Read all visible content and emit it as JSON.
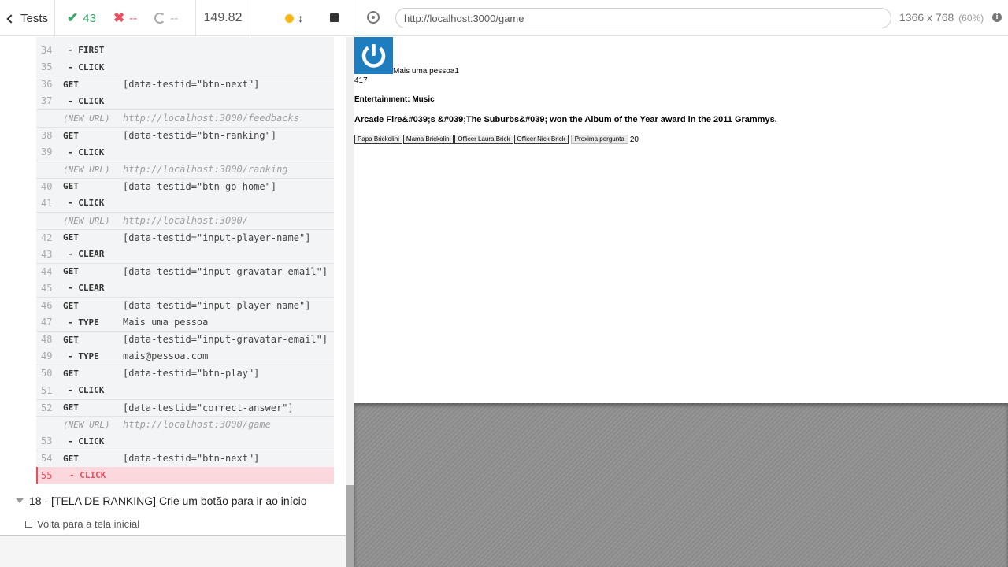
{
  "reporter": {
    "header": {
      "tests_label": "Tests",
      "passed": "43",
      "failed": "--",
      "pending": "--",
      "duration": "149.82"
    },
    "commands": [
      {
        "num": "34",
        "name": "-FIRST",
        "msg": ""
      },
      {
        "num": "35",
        "name": "-CLICK",
        "msg": ""
      },
      {
        "num": "36",
        "name": "GET",
        "msg": "[data-testid=\"btn-next\"]"
      },
      {
        "num": "37",
        "name": "-CLICK",
        "msg": ""
      },
      {
        "num": "",
        "name": "(NEW URL)",
        "msg": "http://localhost:3000/feedbacks"
      },
      {
        "num": "38",
        "name": "GET",
        "msg": "[data-testid=\"btn-ranking\"]"
      },
      {
        "num": "39",
        "name": "-CLICK",
        "msg": ""
      },
      {
        "num": "",
        "name": "(NEW URL)",
        "msg": "http://localhost:3000/ranking"
      },
      {
        "num": "40",
        "name": "GET",
        "msg": "[data-testid=\"btn-go-home\"]"
      },
      {
        "num": "41",
        "name": "-CLICK",
        "msg": ""
      },
      {
        "num": "",
        "name": "(NEW URL)",
        "msg": "http://localhost:3000/"
      },
      {
        "num": "42",
        "name": "GET",
        "msg": "[data-testid=\"input-player-name\"]"
      },
      {
        "num": "43",
        "name": "-CLEAR",
        "msg": ""
      },
      {
        "num": "44",
        "name": "GET",
        "msg": "[data-testid=\"input-gravatar-email\"]"
      },
      {
        "num": "45",
        "name": "-CLEAR",
        "msg": ""
      },
      {
        "num": "46",
        "name": "GET",
        "msg": "[data-testid=\"input-player-name\"]"
      },
      {
        "num": "47",
        "name": "-TYPE",
        "msg": "Mais uma pessoa"
      },
      {
        "num": "48",
        "name": "GET",
        "msg": "[data-testid=\"input-gravatar-email\"]"
      },
      {
        "num": "49",
        "name": "-TYPE",
        "msg": "mais@pessoa.com"
      },
      {
        "num": "50",
        "name": "GET",
        "msg": "[data-testid=\"btn-play\"]"
      },
      {
        "num": "51",
        "name": "-CLICK",
        "msg": ""
      },
      {
        "num": "52",
        "name": "GET",
        "msg": "[data-testid=\"correct-answer\"]"
      },
      {
        "num": "",
        "name": "(NEW URL)",
        "msg": "http://localhost:3000/game"
      },
      {
        "num": "53",
        "name": "-CLICK",
        "msg": ""
      },
      {
        "num": "54",
        "name": "GET",
        "msg": "[data-testid=\"btn-next\"]"
      },
      {
        "num": "55",
        "name": "-CLICK",
        "msg": ""
      }
    ],
    "suite_title": "18 - [TELA DE RANKING] Crie um botão para ir ao início",
    "test_title": "Volta para a tela inicial"
  },
  "aut": {
    "url": "http://localhost:3000/game",
    "viewport": "1366 x 768",
    "scale": "(60%)",
    "game": {
      "player_name": "Mais uma pessoa1",
      "score": "417",
      "category": "Entertainment: Music",
      "question": "Arcade Fire&#039;s &#039;The Suburbs&#039; won the Album of the Year award in the 2011 Grammys.",
      "answers": [
        "Papa Brickolini",
        "Mama Brickolini",
        "Officer Laura Brick",
        "Officer Nick Brick"
      ],
      "next_label": "Proxima pergunta",
      "timer": "20"
    }
  },
  "colors": {
    "passed": "#39a96b",
    "failed": "#e94f5f",
    "running": "#fbb718",
    "avatar_bg": "#1e7dbf"
  },
  "icons": [
    "chevron-left-icon",
    "check-icon",
    "x-icon",
    "pending-spinner-icon",
    "running-dot-icon",
    "scroll-arrows-icon",
    "stop-icon",
    "selector-playground-icon",
    "info-icon",
    "power-icon"
  ]
}
